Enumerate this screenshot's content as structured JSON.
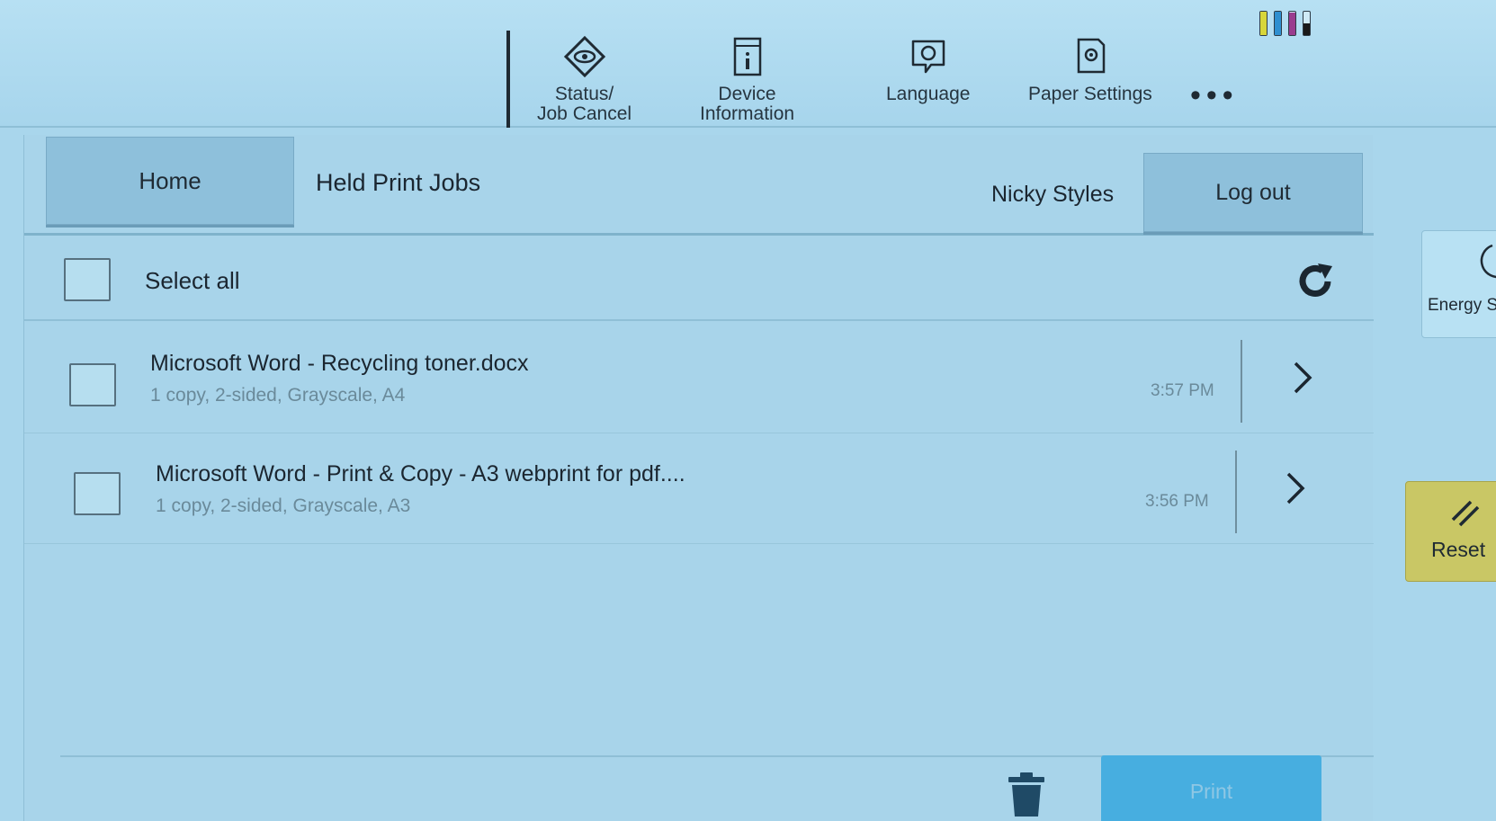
{
  "topbar": {
    "items": [
      {
        "label": "Status/\nJob Cancel",
        "icon": "eye-diamond-icon"
      },
      {
        "label": "Device\nInformation",
        "icon": "info-document-icon"
      },
      {
        "label": "Language",
        "icon": "language-bubble-icon"
      },
      {
        "label": "Paper Settings",
        "icon": "paper-gear-icon"
      }
    ],
    "more_label": "•••",
    "toner_levels": [
      {
        "name": "yellow",
        "color": "#d8d63a",
        "level": 1.0
      },
      {
        "name": "cyan",
        "color": "#2f8fd0",
        "level": 1.0
      },
      {
        "name": "magenta",
        "color": "#9a3c8e",
        "level": 0.95
      },
      {
        "name": "black",
        "color": "#1a1a1a",
        "level": 0.5
      }
    ]
  },
  "header": {
    "home_label": "Home",
    "page_title": "Held Print Jobs",
    "user_name": "Nicky Styles",
    "logout_label": "Log out"
  },
  "list": {
    "select_all_label": "Select all",
    "jobs": [
      {
        "title": "Microsoft Word - Recycling toner.docx",
        "details": "1 copy, 2-sided, Grayscale, A4",
        "time": "3:57 PM"
      },
      {
        "title": "Microsoft Word - Print & Copy - A3 webprint for pdf....",
        "details": "1 copy, 2-sided, Grayscale, A3",
        "time": "3:56 PM"
      }
    ]
  },
  "footer": {
    "print_label": "Print"
  },
  "side": {
    "energy_label": "Energy S",
    "reset_label": "Reset"
  },
  "colors": {
    "screen_bg": "#a9d6ec",
    "button_bg": "#8ec0db",
    "print_button": "#47aee0",
    "reset_button": "#c9c765"
  }
}
